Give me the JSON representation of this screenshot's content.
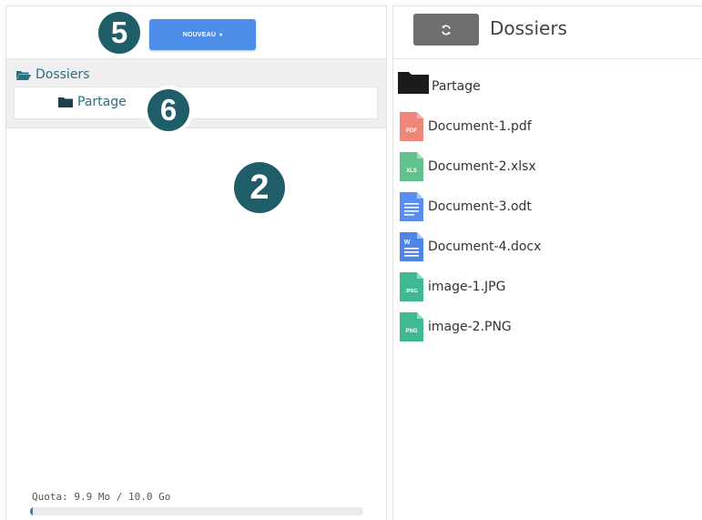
{
  "left_panel": {
    "new_button_label": "NOUVEAU",
    "new_button_caret": "▾",
    "badges": {
      "new_button_callout": "5",
      "tree_child_callout": "6",
      "panel_callout": "2"
    },
    "tree": {
      "root_label": "Dossiers",
      "child_label": "Partage"
    },
    "quota": {
      "label": "Quota: 9.9 Mo / 10.0 Go",
      "used_fraction": 0.001
    }
  },
  "right_panel": {
    "title": "Dossiers",
    "items": [
      {
        "label": "Partage",
        "icon": "folder-icon"
      },
      {
        "label": "Document-1.pdf",
        "icon": "pdf-file-icon",
        "tag": "PDF",
        "color": "#f0857a"
      },
      {
        "label": "Document-2.xlsx",
        "icon": "spreadsheet-file-icon",
        "tag": "XLS",
        "color": "#62c28b"
      },
      {
        "label": "Document-3.odt",
        "icon": "text-document-icon",
        "color": "#5b8def"
      },
      {
        "label": "Document-4.docx",
        "icon": "word-document-icon",
        "tag": "W",
        "color": "#4f86e6"
      },
      {
        "label": "image-1.JPG",
        "icon": "jpeg-image-icon",
        "tag": "JPEG",
        "color": "#3fb894"
      },
      {
        "label": "image-2.PNG",
        "icon": "png-image-icon",
        "tag": "PNG",
        "color": "#3fb894"
      }
    ]
  },
  "colors": {
    "badge": "#1f5d68",
    "primary_button": "#4d8ee8",
    "refresh_button": "#6e6e6e",
    "tree_link": "#2a6f82",
    "quota_fill": "#3a7bd5"
  }
}
